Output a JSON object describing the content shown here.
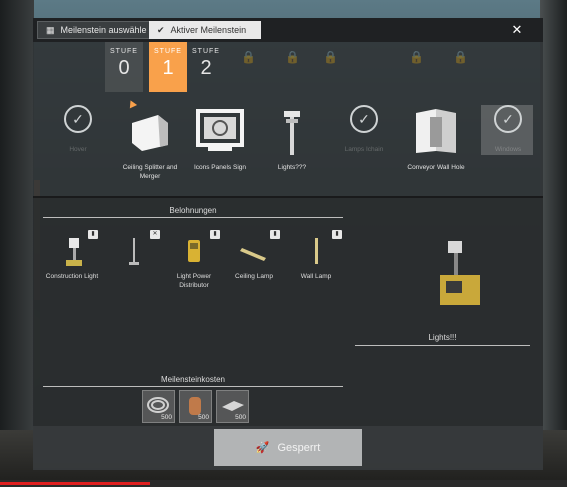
{
  "header": {
    "tab_select_label": "Meilenstein auswähle",
    "tab_active_label": "Aktiver Meilenstein",
    "close_glyph": "✕"
  },
  "tiers": [
    {
      "label": "STUFE",
      "number": "0",
      "state": "completed"
    },
    {
      "label": "STUFE",
      "number": "1",
      "state": "selected"
    },
    {
      "label": "STUFE",
      "number": "2",
      "state": "default"
    }
  ],
  "milestones": [
    {
      "name": "Hover",
      "state": "completed",
      "icon": "check-circle-icon"
    },
    {
      "name": "Ceiling Splitter and Merger",
      "state": "active",
      "icon": "splitter-icon"
    },
    {
      "name": "Icons Panels Sign",
      "state": "active",
      "icon": "sign-panel-icon"
    },
    {
      "name": "Lights???",
      "state": "active",
      "icon": "light-pole-icon"
    },
    {
      "name": "Lamps Ichain",
      "state": "completed",
      "icon": "check-circle-icon"
    },
    {
      "name": "Conveyor Wall Hole",
      "state": "active",
      "icon": "wall-hole-icon"
    },
    {
      "name": "Windows",
      "state": "completed",
      "icon": "check-circle-icon"
    }
  ],
  "rewards_section": {
    "title": "Belohnungen",
    "items": [
      {
        "name": "Construction Light",
        "icon": "construction-light-icon",
        "badge": "building"
      },
      {
        "name": "",
        "icon": "lamp-post-icon",
        "badge": "tool"
      },
      {
        "name": "Light Power Distributor",
        "icon": "power-distributor-icon",
        "badge": "building"
      },
      {
        "name": "Ceiling Lamp",
        "icon": "ceiling-lamp-icon",
        "badge": "building"
      },
      {
        "name": "Wall Lamp",
        "icon": "wall-lamp-icon",
        "badge": "building"
      }
    ],
    "preview_title": "Lights!!!"
  },
  "cost_section": {
    "title": "Meilensteinkosten",
    "items": [
      {
        "icon": "wire-coil-icon",
        "amount": "500"
      },
      {
        "icon": "copper-spool-icon",
        "amount": "500"
      },
      {
        "icon": "steel-sheet-icon",
        "amount": "500"
      }
    ]
  },
  "action": {
    "label": "Gesperrt",
    "icon": "rocket-icon"
  },
  "colors": {
    "accent": "#f9a14b",
    "panel": "#303436"
  }
}
